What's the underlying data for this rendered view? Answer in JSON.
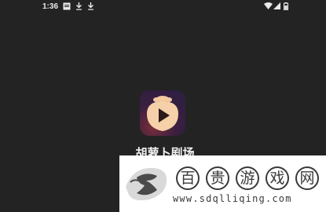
{
  "status_bar": {
    "time": "1:36",
    "left_icons": [
      "notification-box-icon",
      "download-icon",
      "download-icon"
    ],
    "right_icons": [
      "wifi-icon",
      "signal-icon",
      "battery-icon"
    ]
  },
  "splash": {
    "app_name": "胡萝卜剧场",
    "icon": "play-button-app-icon"
  },
  "watermark": {
    "title_chars": [
      "百",
      "贵",
      "游",
      "戏",
      "网"
    ],
    "url": "www.sdqlliqing.com"
  },
  "colors": {
    "background": "#232323",
    "status_text": "#eaeaea",
    "app_name": "#f2f2f2",
    "watermark_bg": "#ffffff",
    "watermark_text": "#3a3a3a"
  }
}
